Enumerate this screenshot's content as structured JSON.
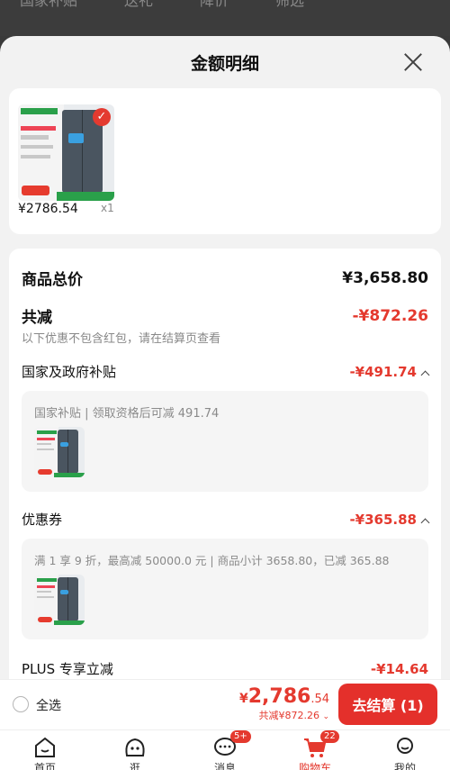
{
  "background_tabs": [
    "国家补贴",
    "送礼",
    "降价",
    "筛选"
  ],
  "sheet": {
    "title": "金额明细"
  },
  "product": {
    "price": "¥2786.54",
    "qty": "x1"
  },
  "summary": {
    "total_label": "商品总价",
    "total_value": "¥3,658.80",
    "discount_label": "共减",
    "discount_value": "-¥872.26",
    "discount_note": "以下优惠不包含红包，请在结算页查看"
  },
  "subsidy": {
    "label": "国家及政府补贴",
    "value": "-¥491.74",
    "detail": "国家补贴 | 领取资格后可减 491.74"
  },
  "coupon": {
    "label": "优惠券",
    "value": "-¥365.88",
    "detail": "满 1 享 9 折，最高减 50000.0 元 | 商品小计 3658.80，已减 365.88"
  },
  "plus": {
    "label": "PLUS 专享立减",
    "value": "-¥14.64"
  },
  "checkout": {
    "select_all": "全选",
    "yen": "¥",
    "total_int": "2,786",
    "total_dec": ".54",
    "saved": "共减¥872.26",
    "button": "去结算 (1)"
  },
  "tabbar": [
    {
      "label": "首页",
      "icon": "home-icon"
    },
    {
      "label": "逛",
      "icon": "face-icon"
    },
    {
      "label": "消息",
      "icon": "chat-icon",
      "badge": "5+"
    },
    {
      "label": "购物车",
      "icon": "cart-icon",
      "badge": "22"
    },
    {
      "label": "我的",
      "icon": "user-icon"
    }
  ],
  "accent_color": "#e4392e"
}
